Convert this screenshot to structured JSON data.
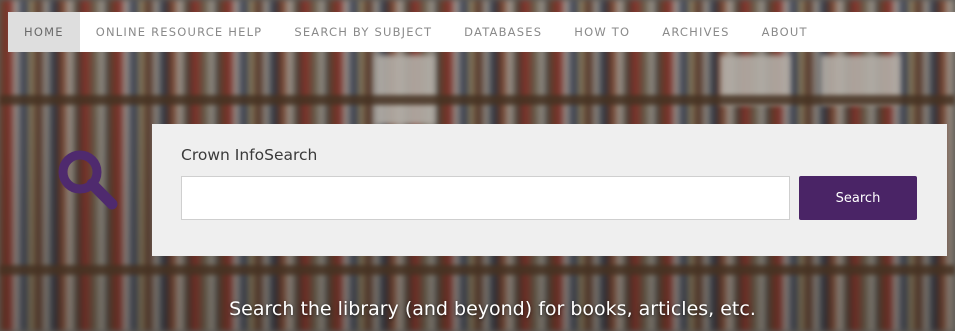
{
  "nav": {
    "items": [
      {
        "label": "HOME",
        "active": true
      },
      {
        "label": "ONLINE RESOURCE HELP",
        "active": false
      },
      {
        "label": "SEARCH BY SUBJECT",
        "active": false
      },
      {
        "label": "DATABASES",
        "active": false
      },
      {
        "label": "HOW TO",
        "active": false
      },
      {
        "label": "ARCHIVES",
        "active": false
      },
      {
        "label": "ABOUT",
        "active": false
      }
    ]
  },
  "search": {
    "title": "Crown InfoSearch",
    "input_value": "",
    "button_label": "Search"
  },
  "tagline": "Search the library (and beyond) for books, articles, etc.",
  "colors": {
    "accent": "#4a2466",
    "icon": "#4f2a6e",
    "nav_active_bg": "#dedede"
  },
  "icons": {
    "search": "magnifier-icon"
  }
}
